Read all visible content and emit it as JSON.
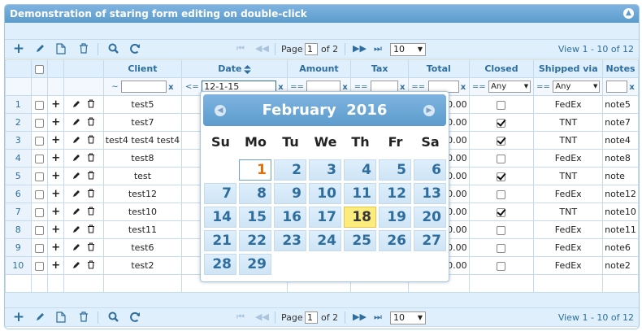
{
  "title": "Demonstration of staring form editing on double-click",
  "pager": {
    "page_label": "Page",
    "page": "1",
    "of_label": "of 2",
    "rows": "10",
    "view": "View 1 - 10 of 12"
  },
  "columns": {
    "client": "Client",
    "date": "Date",
    "amount": "Amount",
    "tax": "Tax",
    "total": "Total",
    "closed": "Closed",
    "shipped": "Shipped via",
    "notes": "Notes"
  },
  "filter": {
    "client_op": "~",
    "date_op": "<=",
    "date_value": "12-1-15",
    "amount_op": "==",
    "tax_op": "==",
    "total_op": "==",
    "closed_op": "==",
    "closed_value": "Any",
    "shipped_op": "==",
    "shipped_value": "Any",
    "clear": "x"
  },
  "rows": [
    {
      "n": "1",
      "client": "test5",
      "total": "0.00",
      "closed": false,
      "shipped": "FedEx",
      "notes": "note5"
    },
    {
      "n": "2",
      "client": "test7",
      "total": "0.00",
      "closed": true,
      "shipped": "TNT",
      "notes": "note7"
    },
    {
      "n": "3",
      "client": "test4 test4 test4",
      "total": "0.00",
      "closed": true,
      "shipped": "TNT",
      "notes": "note4"
    },
    {
      "n": "4",
      "client": "test8",
      "total": "0.00",
      "closed": false,
      "shipped": "FedEx",
      "notes": "note8"
    },
    {
      "n": "5",
      "client": "test",
      "total": "0.00",
      "closed": true,
      "shipped": "TNT",
      "notes": "note"
    },
    {
      "n": "6",
      "client": "test12",
      "total": "0.00",
      "closed": false,
      "shipped": "FedEx",
      "notes": "note12"
    },
    {
      "n": "7",
      "client": "test10",
      "total": "0.00",
      "closed": true,
      "shipped": "TNT",
      "notes": "note10"
    },
    {
      "n": "8",
      "client": "test11",
      "total": "0.00",
      "closed": false,
      "shipped": "FedEx",
      "notes": "note11"
    },
    {
      "n": "9",
      "client": "test6",
      "total": "0.00",
      "closed": false,
      "shipped": "FedEx",
      "notes": "note6"
    },
    {
      "n": "10",
      "client": "test2",
      "total": "0.00",
      "closed": false,
      "shipped": "FedEx",
      "notes": "note2"
    }
  ],
  "calendar": {
    "month": "February",
    "year": "2016",
    "weekdays": [
      "Su",
      "Mo",
      "Tu",
      "We",
      "Th",
      "Fr",
      "Sa"
    ],
    "days": [
      "1",
      "2",
      "3",
      "4",
      "5",
      "6",
      "7",
      "8",
      "9",
      "10",
      "11",
      "12",
      "13",
      "14",
      "15",
      "16",
      "17",
      "18",
      "19",
      "20",
      "21",
      "22",
      "23",
      "24",
      "25",
      "26",
      "27",
      "28",
      "29"
    ],
    "first_weekday": 1,
    "today": "18",
    "selected": "1"
  },
  "colors": {
    "accent": "#5c9ccc",
    "header_bg": "#dfeffc",
    "today": "#fcec7e"
  }
}
